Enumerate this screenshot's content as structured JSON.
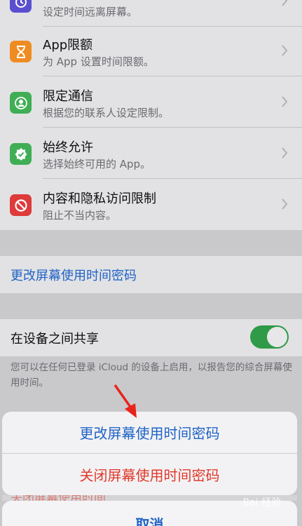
{
  "settings": {
    "items": [
      {
        "title": "",
        "subtitle": "设定时间远离屏幕。",
        "icon": "downtime-icon",
        "color": "#5a4fcf"
      },
      {
        "title": "App限额",
        "subtitle": "为 App 设置时间限额。",
        "icon": "hourglass-icon",
        "color": "#ef8c21"
      },
      {
        "title": "限定通信",
        "subtitle": "根据您的联系人设定限制。",
        "icon": "contact-icon",
        "color": "#3fae55"
      },
      {
        "title": "始终允许",
        "subtitle": "选择始终可用的 App。",
        "icon": "check-badge-icon",
        "color": "#3fae55"
      },
      {
        "title": "内容和隐私访问限制",
        "subtitle": "阻止不当内容。",
        "icon": "restriction-icon",
        "color": "#de3b3b"
      }
    ]
  },
  "passcode_link": "更改屏幕使用时间密码",
  "share": {
    "label": "在设备之间共享",
    "toggle_on": true,
    "toggle_color": "#2f9a47",
    "footnote": "您可以在任何已登录 iCloud 的设备上启用，以报告您的综合屏幕使用时间。"
  },
  "action_sheet": {
    "change_label": "更改屏幕使用时间密码",
    "turn_off_label": "关闭屏幕使用时间密码",
    "behind_text": "关闭屏幕使用时间",
    "cancel_label": "取消"
  },
  "watermark": "Bai 经验",
  "colors": {
    "accent": "#1f63c6",
    "destructive": "#e0392b"
  }
}
